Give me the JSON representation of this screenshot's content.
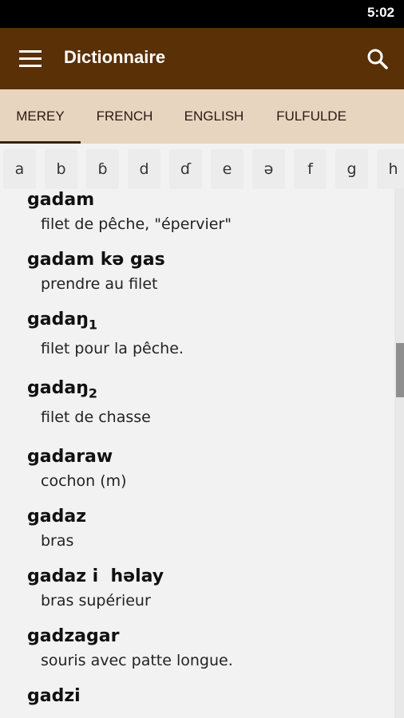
{
  "status_bar": {
    "time": "5:02"
  },
  "app_bar": {
    "title": "Dictionnaire",
    "menu_icon": "menu-icon",
    "search_icon": "search-icon"
  },
  "tabs": [
    {
      "label": "MEREY",
      "active": true
    },
    {
      "label": "FRENCH",
      "active": false
    },
    {
      "label": "ENGLISH",
      "active": false
    },
    {
      "label": "FULFULDE",
      "active": false
    }
  ],
  "alphabet": [
    "a",
    "b",
    "ɓ",
    "d",
    "ɗ",
    "e",
    "ə",
    "f",
    "g",
    "h"
  ],
  "entries": [
    {
      "word": "gadam",
      "sub": "",
      "gloss": "filet de pêche, \"épervier\""
    },
    {
      "word": "gadam kə gas",
      "sub": "",
      "gloss": "prendre au filet"
    },
    {
      "word": "gadaŋ",
      "sub": "1",
      "gloss": "filet pour la pêche."
    },
    {
      "word": "gadaŋ",
      "sub": "2",
      "gloss": "filet de chasse"
    },
    {
      "word": "gadaraw",
      "sub": "",
      "gloss": "cochon (m)"
    },
    {
      "word": "gadaz",
      "sub": "",
      "gloss": "bras"
    },
    {
      "word": "gadaz i  həlay",
      "sub": "",
      "gloss": "bras supérieur"
    },
    {
      "word": "gadzagar",
      "sub": "",
      "gloss": "souris avec patte longue."
    },
    {
      "word": "gadzi",
      "sub": "",
      "gloss": ""
    }
  ],
  "colors": {
    "app_bar": "#5a3007",
    "tab_bar": "#e7d5c0",
    "background": "#f2f2f2"
  }
}
